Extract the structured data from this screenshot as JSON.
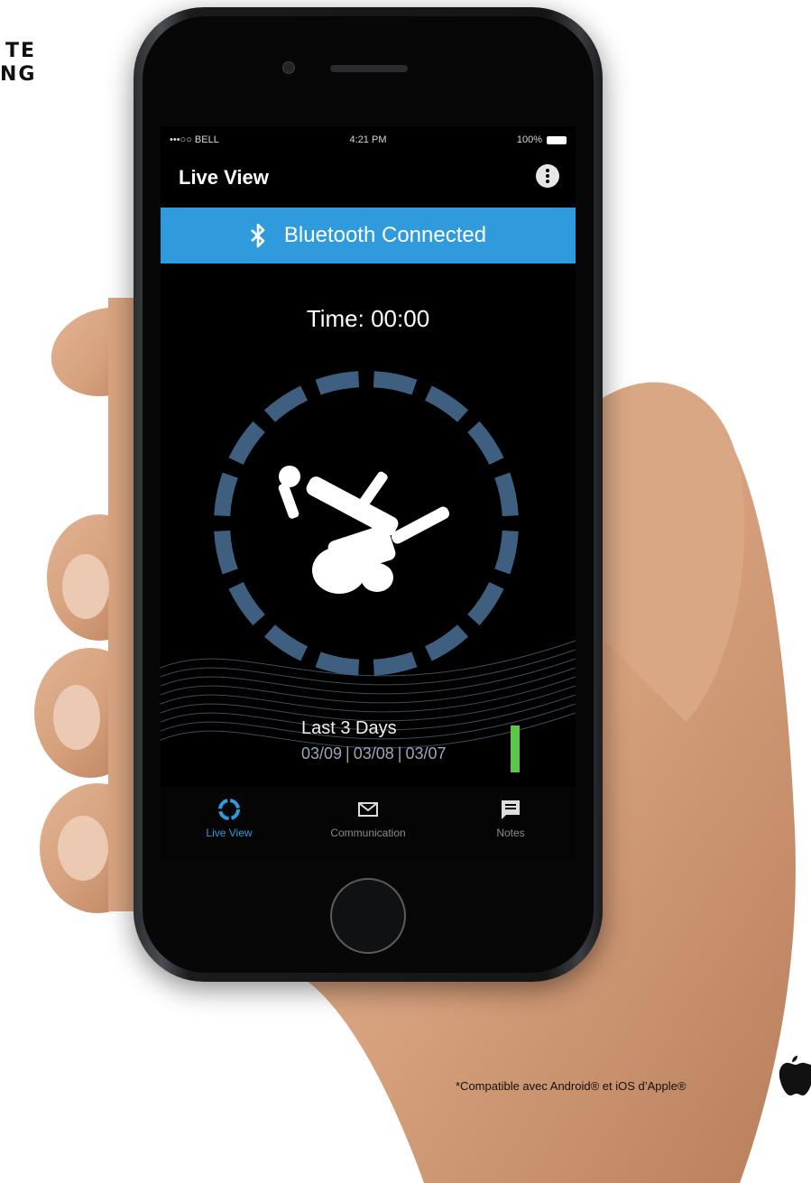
{
  "logo_fragment": [
    "TE",
    "NG"
  ],
  "status_bar": {
    "carrier": "•••○○ BELL",
    "time": "4:21 PM",
    "battery": "100%"
  },
  "header": {
    "title": "Live View",
    "menu_icon": "more-vertical-icon"
  },
  "bluetooth": {
    "label": "Bluetooth Connected",
    "icon": "bluetooth-icon",
    "color": "#2f9bdc"
  },
  "timer": {
    "label": "Time: 00:00"
  },
  "summary": {
    "title": "Last 3 Days",
    "dates": [
      "03/09",
      "03/08",
      "03/07"
    ],
    "indicator_color": "#5cc64a"
  },
  "tabs": [
    {
      "label": "Live View",
      "icon": "live-view-ring-icon",
      "active": true
    },
    {
      "label": "Communication",
      "icon": "envelope-icon",
      "active": false
    },
    {
      "label": "Notes",
      "icon": "notes-icon",
      "active": false
    }
  ],
  "footnote": "*Compatible avec Android® et iOS d’Apple®",
  "colors": {
    "accent": "#2f9bdc",
    "ring": "#3f5f80",
    "active_green": "#5cc64a"
  }
}
